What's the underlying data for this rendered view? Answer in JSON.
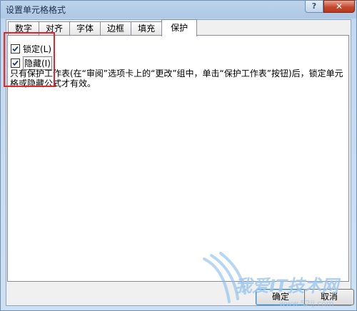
{
  "window": {
    "title": "设置单元格格式"
  },
  "controls": {
    "help": "?",
    "close": "✕"
  },
  "tabs": [
    {
      "label": "数字",
      "active": false
    },
    {
      "label": "对齐",
      "active": false
    },
    {
      "label": "字体",
      "active": false
    },
    {
      "label": "边框",
      "active": false
    },
    {
      "label": "填充",
      "active": false
    },
    {
      "label": "保护",
      "active": true
    }
  ],
  "protection": {
    "locked": {
      "label": "锁定(L)",
      "checked": true
    },
    "hidden": {
      "label": "隐藏(I)",
      "checked": true
    },
    "note": "只有保护工作表(在“审阅”选项卡上的“更改”组中，单击“保护工作表”按钮)后，锁定单元格或隐藏公式才有效。"
  },
  "buttons": {
    "ok": "确定",
    "cancel": "取消"
  },
  "watermark": {
    "text": "我爱IT技术网",
    "url": "www.52ij.com"
  },
  "colors": {
    "highlight": "#e0262a",
    "titlebar": "#bcd3ea",
    "close": "#c54a30"
  }
}
